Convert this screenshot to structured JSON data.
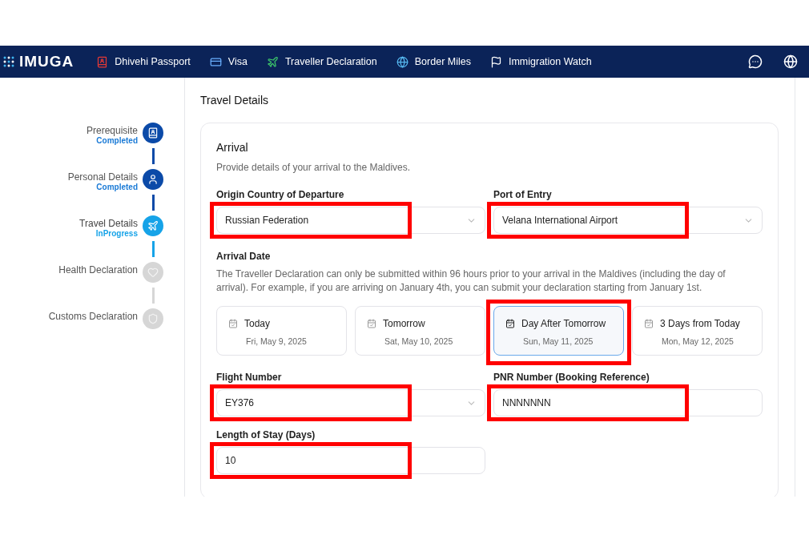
{
  "navbar": {
    "logo": "IMUGA",
    "items": [
      {
        "label": "Dhivehi Passport"
      },
      {
        "label": "Visa"
      },
      {
        "label": "Traveller Declaration"
      },
      {
        "label": "Border Miles"
      },
      {
        "label": "Immigration Watch"
      }
    ]
  },
  "steps": [
    {
      "label": "Prerequisite",
      "done": true,
      "active": false,
      "status_text": "Completed"
    },
    {
      "label": "Personal Details",
      "done": true,
      "active": false,
      "status_text": "Completed"
    },
    {
      "label": "Travel Details",
      "done": false,
      "active": true,
      "status_text": "InProgress"
    },
    {
      "label": "Health Declaration",
      "done": false,
      "active": false
    },
    {
      "label": "Customs Declaration",
      "done": false,
      "active": false
    }
  ],
  "page_title": "Travel Details",
  "section": {
    "title": "Arrival",
    "description": "Provide details of your arrival to the Maldives.",
    "rows": [
      [
        {
          "label": "Origin Country of Departure",
          "kind": "select",
          "value": "Russian Federation",
          "highlighted": true
        },
        {
          "label": "Port of Entry",
          "kind": "select",
          "value": "Velana International Airport",
          "highlighted": true
        }
      ]
    ],
    "arrival_date": {
      "label": "Arrival Date",
      "note": "The Traveller Declaration can only be submitted within 96 hours prior to your arrival in the Maldives (including the day of arrival). For example, if you are arriving on January 4th, you can submit your declaration starting from January 1st.",
      "options": [
        {
          "title": "Today",
          "date": "Fri, May 9, 2025",
          "selected": false,
          "highlighted": false
        },
        {
          "title": "Tomorrow",
          "date": "Sat, May 10, 2025",
          "selected": false,
          "highlighted": false
        },
        {
          "title": "Day After Tomorrow",
          "date": "Sun, May 11, 2025",
          "selected": true,
          "highlighted": true
        },
        {
          "title": "3 Days from Today",
          "date": "Mon, May 12, 2025",
          "selected": false,
          "highlighted": false
        }
      ]
    },
    "rows2": [
      [
        {
          "label": "Flight Number",
          "kind": "select",
          "value": "EY376",
          "highlighted": true
        },
        {
          "label": "PNR Number (Booking Reference)",
          "kind": "input",
          "value": "NNNNNNN",
          "highlighted": true
        }
      ],
      [
        {
          "label": "Length of Stay (Days)",
          "kind": "input",
          "value": "10",
          "highlighted": true
        }
      ]
    ]
  }
}
